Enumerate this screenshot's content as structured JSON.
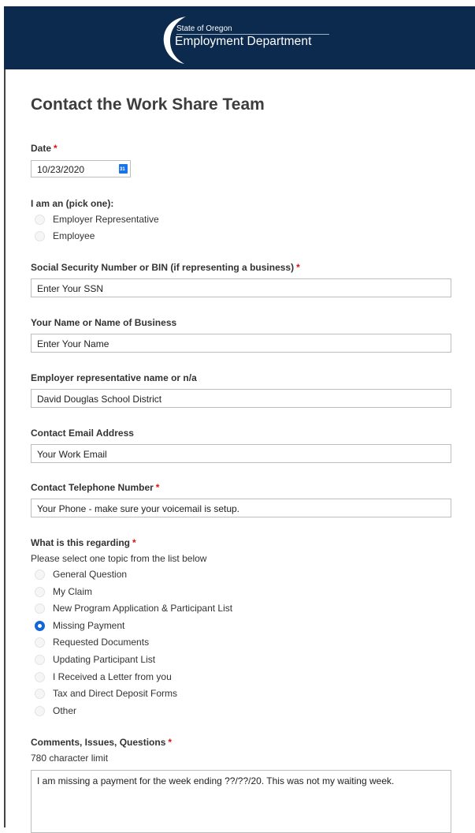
{
  "header": {
    "logo_small": "State of Oregon",
    "logo_big": "Employment Department",
    "colors": {
      "banner": "#0b2a4e",
      "text": "#ffffff"
    }
  },
  "form": {
    "title": "Contact the Work Share Team",
    "required_mark": "*",
    "date": {
      "label": "Date",
      "value": "10/23/2020",
      "icon": "calendar-icon"
    },
    "role": {
      "label": "I am an (pick one):",
      "options": [
        "Employer Representative",
        "Employee"
      ]
    },
    "ssn": {
      "label": "Social Security Number or BIN (if representing a business)",
      "value": "Enter Your SSN"
    },
    "name": {
      "label": "Your Name or Name of Business",
      "value": "Enter Your Name"
    },
    "employer_rep": {
      "label": "Employer representative name or n/a",
      "value": "David Douglas School District"
    },
    "email": {
      "label": "Contact Email Address",
      "value": "Your Work Email"
    },
    "phone": {
      "label": "Contact Telephone Number",
      "value": "Your Phone - make sure your voicemail is setup."
    },
    "regarding": {
      "label": "What is this regarding",
      "hint": "Please select one topic from the list below",
      "options": [
        "General Question",
        "My Claim",
        "New Program Application & Participant List",
        "Missing Payment",
        "Requested Documents",
        "Updating Participant List",
        "I Received a Letter from you",
        "Tax and Direct Deposit Forms",
        "Other"
      ],
      "selected": "Missing Payment"
    },
    "comments": {
      "label": "Comments, Issues, Questions",
      "hint": "780 character limit",
      "value": "I am missing a payment for the week ending ??/??/20. This was not my waiting week."
    }
  },
  "colors": {
    "required": "#dd1111",
    "radio_selected": "#1267d6"
  }
}
